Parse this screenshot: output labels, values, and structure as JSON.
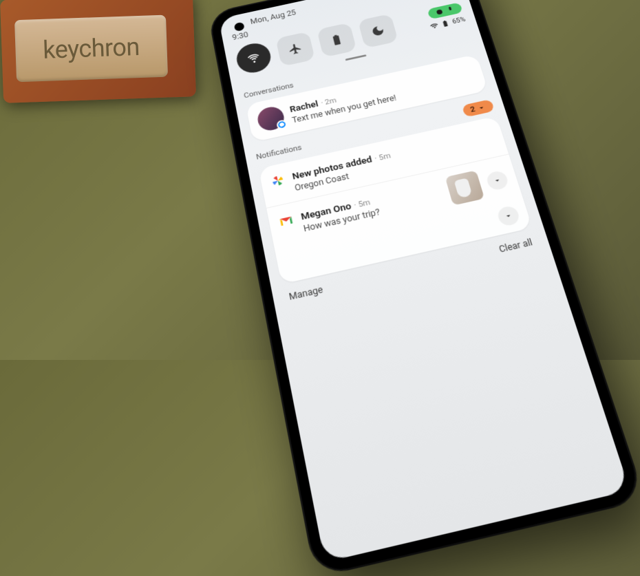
{
  "background_brand": "keychron",
  "status": {
    "date": "Mon, Aug 25",
    "time": "9:30",
    "battery_percent": "65%"
  },
  "quick_settings": {
    "wifi": {
      "active": true,
      "name": "wifi"
    },
    "airplane": {
      "active": false,
      "name": "airplane-mode"
    },
    "battery_saver": {
      "active": false,
      "name": "battery-saver"
    },
    "dnd": {
      "active": false,
      "name": "do-not-disturb"
    }
  },
  "sections": {
    "conversations_label": "Conversations",
    "notifications_label": "Notifications"
  },
  "conversation": {
    "sender": "Rachel",
    "time": "2m",
    "body": "Text me when you get here!",
    "app": "messenger"
  },
  "notifications": {
    "count_badge": "2",
    "items": [
      {
        "app": "photos",
        "title": "New photos added",
        "time": "5m",
        "body": "Oregon Coast",
        "has_thumb": false
      },
      {
        "app": "gmail",
        "title": "Megan Ono",
        "time": "5m",
        "body": "How was your trip?",
        "has_thumb": true
      }
    ]
  },
  "footer": {
    "manage": "Manage",
    "clear": "Clear all"
  }
}
